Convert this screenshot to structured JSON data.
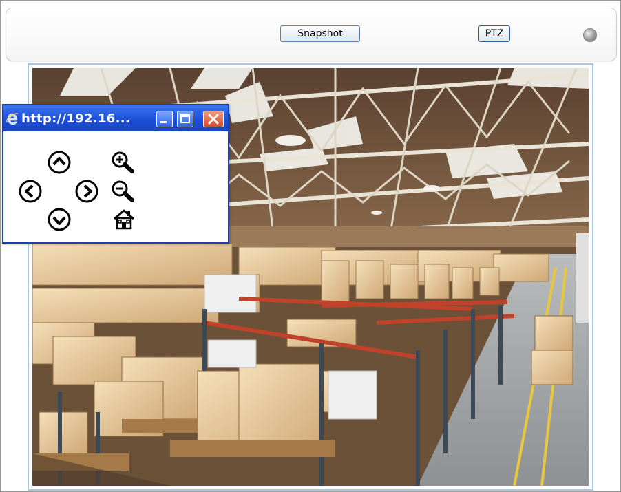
{
  "toolbar": {
    "snapshot_label": "Snapshot",
    "ptz_label": "PTZ",
    "status_led": {
      "icon": "status-led-icon",
      "color": "#9a9a9a"
    }
  },
  "video": {
    "icon": "camera-feed-warehouse-image"
  },
  "ptz_window": {
    "title": "http://192.16...",
    "controls": {
      "up": "arrow-up-icon",
      "down": "arrow-down-icon",
      "left": "arrow-left-icon",
      "right": "arrow-right-icon",
      "zoom_in": "zoom-in-icon",
      "zoom_out": "zoom-out-icon",
      "home": "home-icon"
    }
  },
  "colors": {
    "titlebar": "#1c4fd8",
    "close_button": "#d9492a",
    "button_border": "#5b7fa8",
    "video_border": "#a8c6e6"
  }
}
